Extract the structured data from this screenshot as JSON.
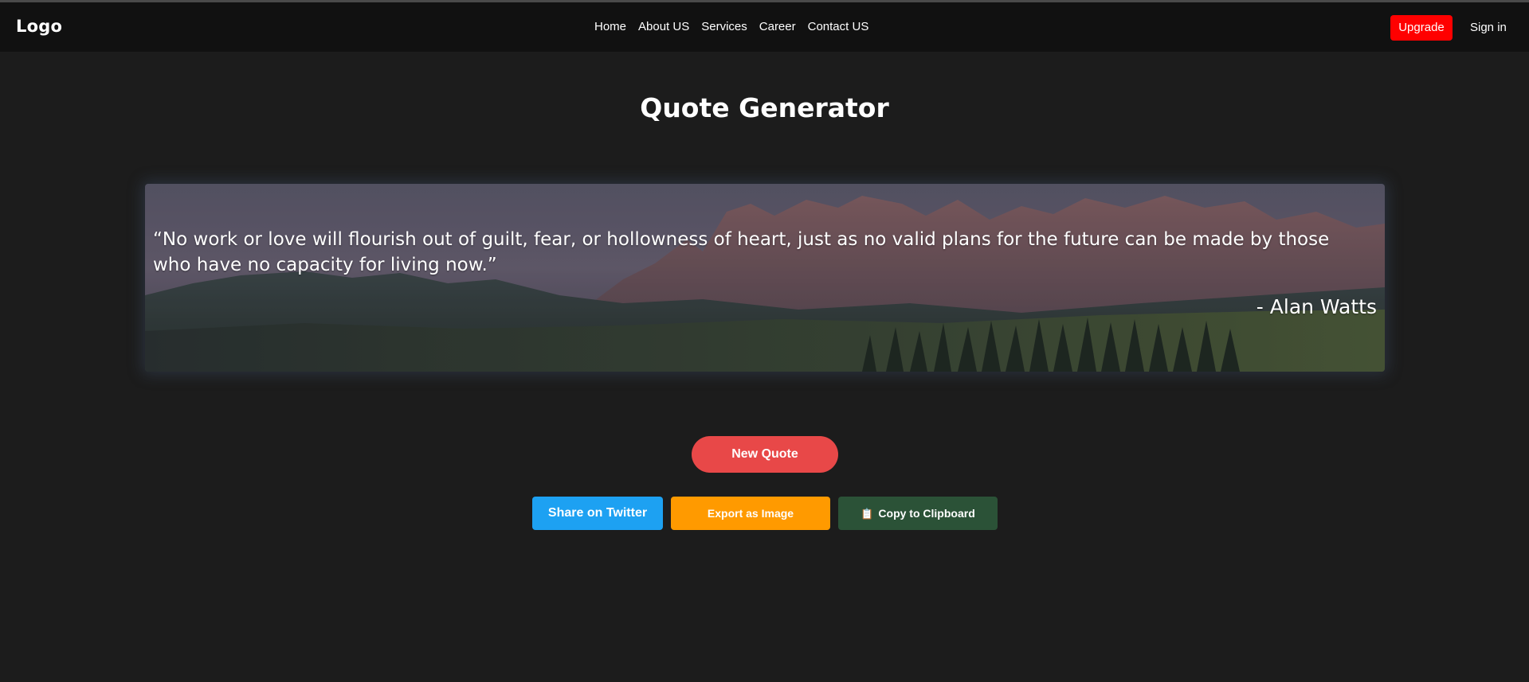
{
  "nav": {
    "logo": "Logo",
    "links": [
      "Home",
      "About US",
      "Services",
      "Career",
      "Contact US"
    ],
    "upgrade_label": "Upgrade",
    "signin_label": "Sign in"
  },
  "page": {
    "title": "Quote Generator"
  },
  "quote": {
    "text": "“No work or love will flourish out of guilt, fear, or hollowness of heart, just as no valid plans for the future can be made by those who have no capacity for living now.”",
    "author": "- Alan Watts"
  },
  "actions": {
    "new_quote_label": "New Quote",
    "twitter_label": "Share on Twitter",
    "export_label": "Export as Image",
    "copy_icon": "clipboard-icon",
    "copy_label": "Copy to Clipboard"
  },
  "colors": {
    "background": "#1c1c1c",
    "navbar": "#111111",
    "upgrade": "#ff0000",
    "new_quote": "#e84848",
    "twitter": "#1da1f2",
    "export": "#ff9a00",
    "copy": "#2b5237"
  }
}
